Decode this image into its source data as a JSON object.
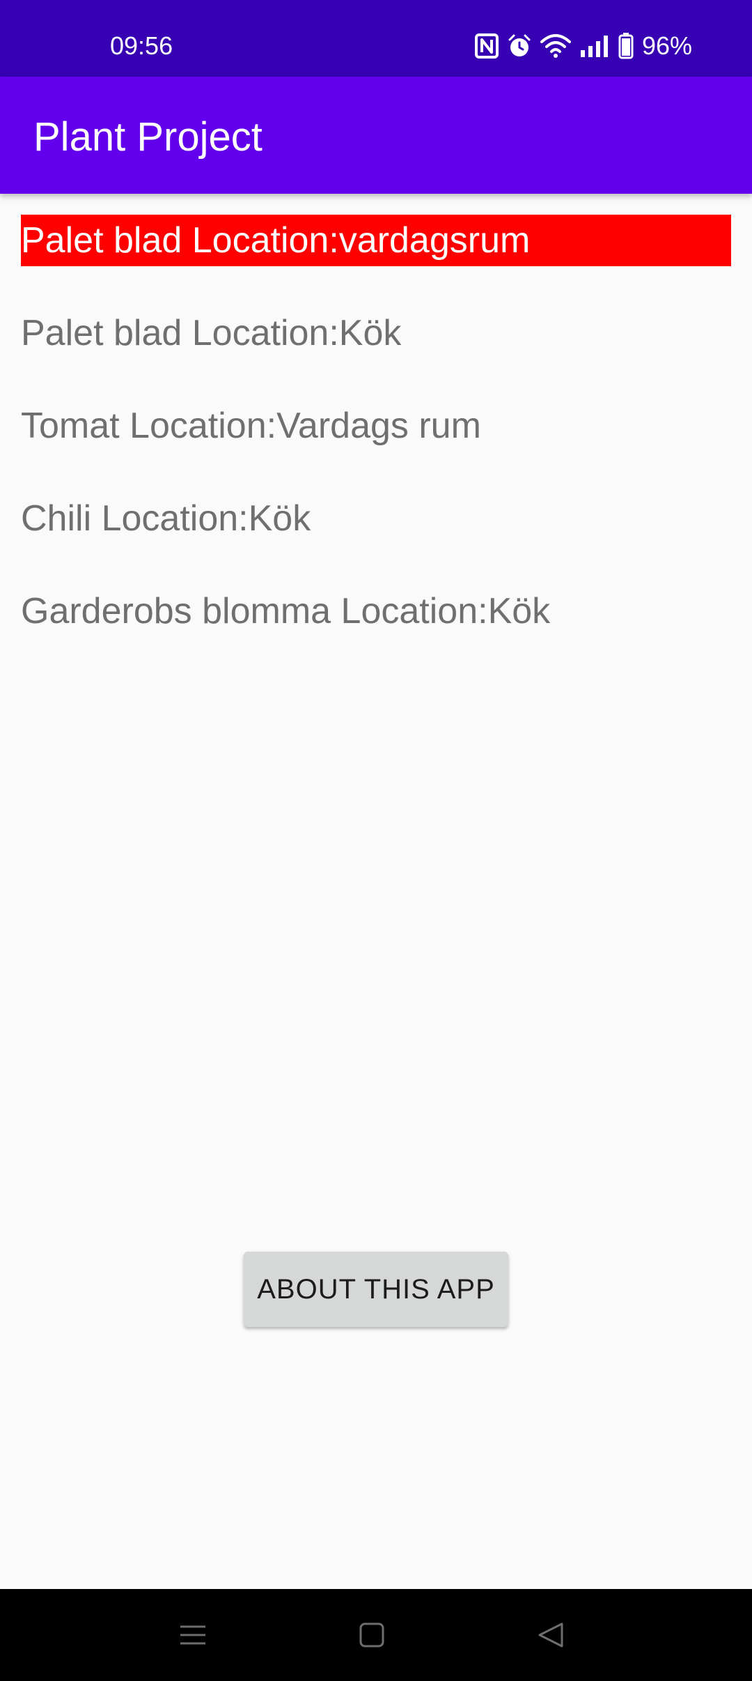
{
  "status_bar": {
    "time": "09:56",
    "battery_percent": "96%",
    "icons": [
      "nfc-icon",
      "alarm-icon",
      "wifi-icon",
      "signal-icon",
      "battery-icon"
    ]
  },
  "app_bar": {
    "title": "Plant Project"
  },
  "plants": [
    {
      "label": "Palet blad Location:vardagsrum",
      "selected": true
    },
    {
      "label": "Palet blad Location:Kök",
      "selected": false
    },
    {
      "label": "Tomat Location:Vardags rum",
      "selected": false
    },
    {
      "label": "Chili Location:Kök",
      "selected": false
    },
    {
      "label": "Garderobs blomma Location:Kök",
      "selected": false
    }
  ],
  "about_button": {
    "label": "ABOUT THIS APP"
  },
  "nav_bar": {
    "icons": [
      "menu-icon",
      "home-icon",
      "back-icon"
    ]
  },
  "colors": {
    "status_bar": "#3700b3",
    "app_bar": "#6200ee",
    "selected_item": "#ff0000",
    "background": "#fafafa",
    "button": "#d6d7d7"
  }
}
